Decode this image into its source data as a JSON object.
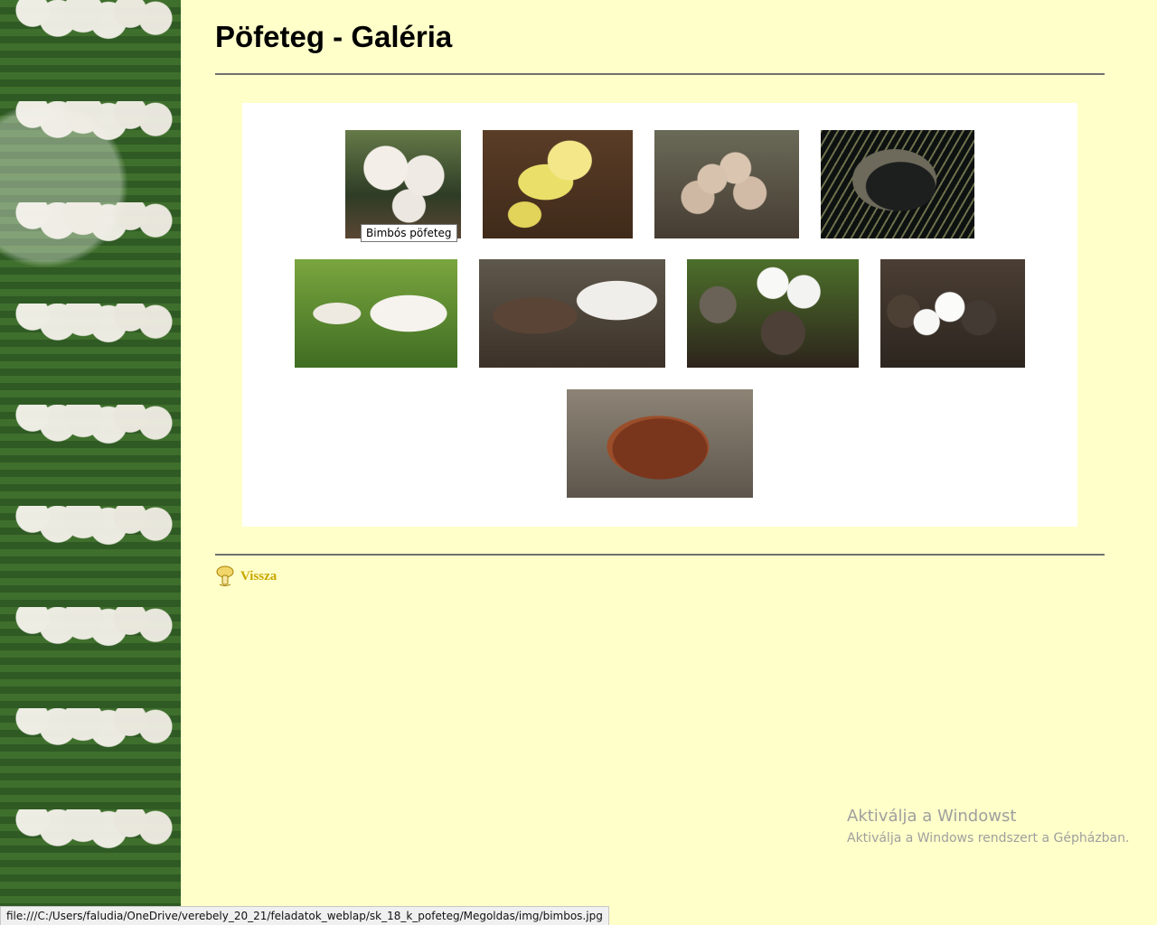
{
  "page": {
    "title": "Pöfeteg - Galéria"
  },
  "gallery": {
    "tooltip": "Bimbós pöfeteg",
    "items": [
      {
        "name": "bimbos-pofeteg-thumbnail"
      },
      {
        "name": "yellow-mushroom-thumbnail"
      },
      {
        "name": "pale-puffballs-thumbnail"
      },
      {
        "name": "dark-cracked-puffball-thumbnail"
      },
      {
        "name": "giant-white-puffball-thumbnail"
      },
      {
        "name": "cut-puffball-thumbnail"
      },
      {
        "name": "puffballs-in-grass-thumbnail"
      },
      {
        "name": "white-and-dark-puffballs-thumbnail"
      },
      {
        "name": "brown-puffball-thumbnail"
      }
    ]
  },
  "navigation": {
    "back_label": "Vissza"
  },
  "watermark": {
    "line1": "Aktiválja a Windowst",
    "line2": "Aktiválja a Windows rendszert a Gépházban."
  },
  "statusbar": {
    "url": "file:///C:/Users/faludia/OneDrive/verebely_20_21/feladatok_weblap/sk_18_k_pofeteg/Megoldas/img/bimbos.jpg"
  },
  "colors": {
    "background": "#ffffc9",
    "back_link": "#c9a600"
  }
}
